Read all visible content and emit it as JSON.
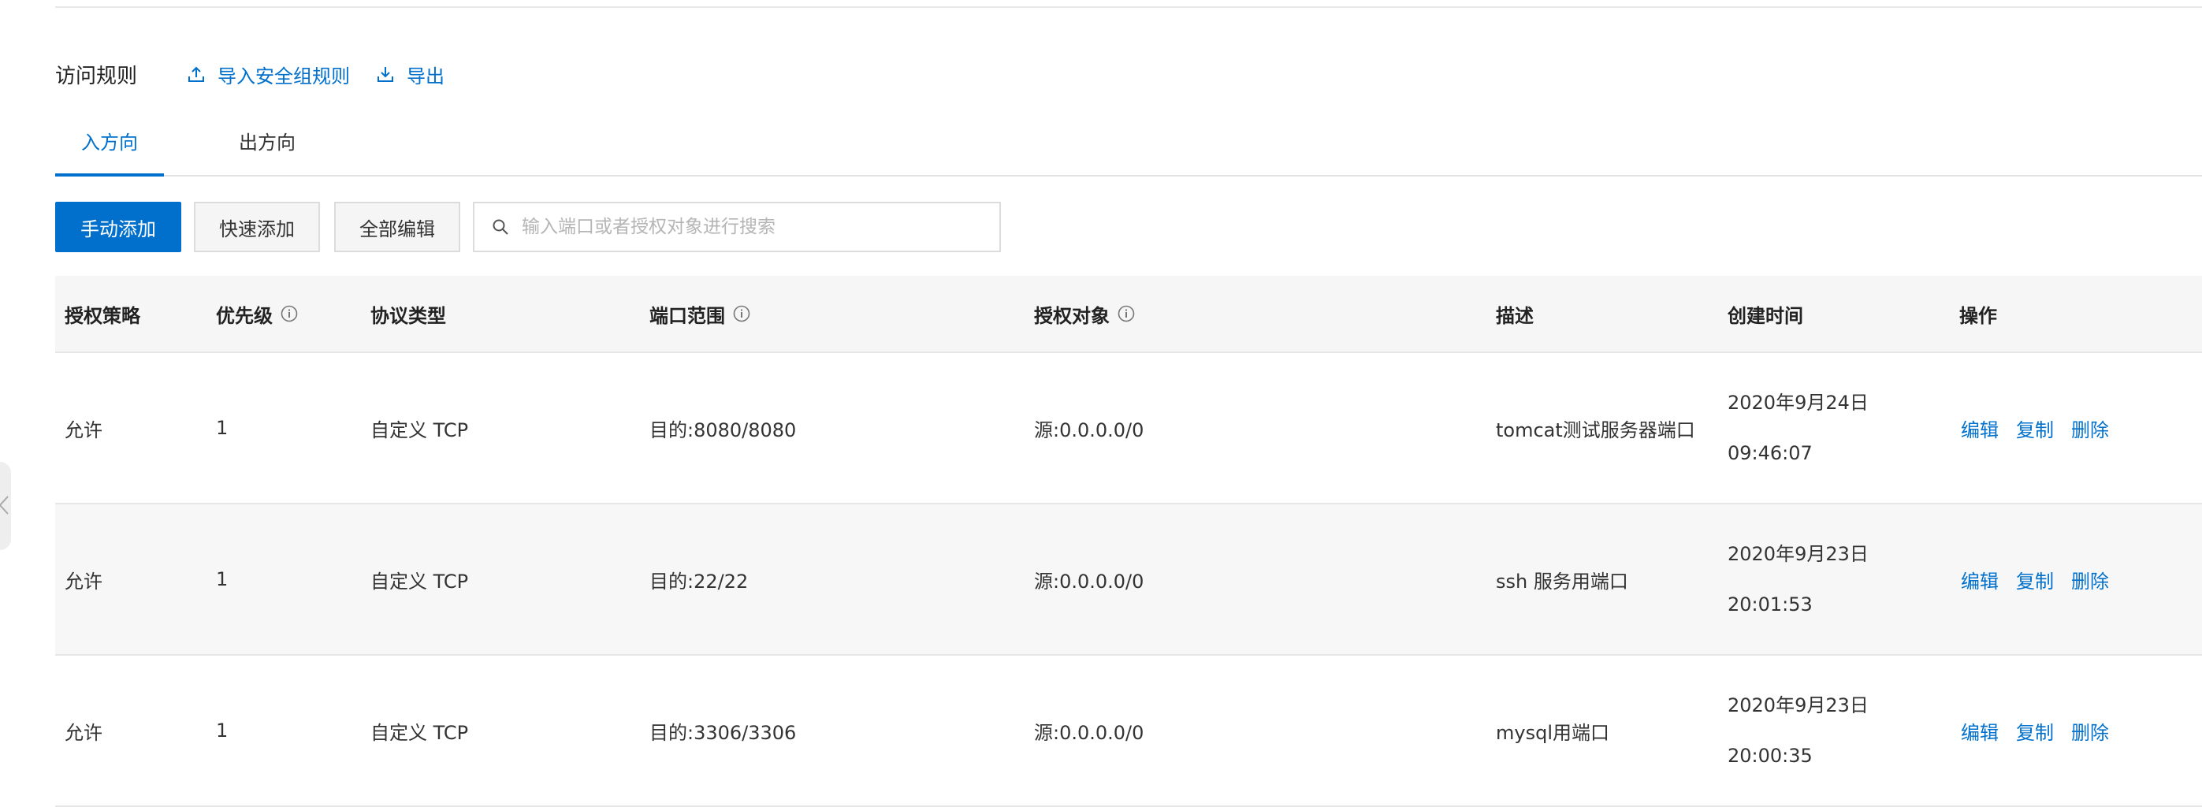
{
  "header": {
    "title": "访问规则",
    "import_label": "导入安全组规则",
    "export_label": "导出"
  },
  "tabs": [
    {
      "label": "入方向",
      "active": true
    },
    {
      "label": "出方向",
      "active": false
    }
  ],
  "toolbar": {
    "manual_add": "手动添加",
    "quick_add": "快速添加",
    "edit_all": "全部编辑",
    "search_placeholder": "输入端口或者授权对象进行搜索",
    "search_value": ""
  },
  "table": {
    "columns": [
      "授权策略",
      "优先级",
      "协议类型",
      "端口范围",
      "授权对象",
      "描述",
      "创建时间",
      "操作"
    ],
    "rows": [
      {
        "policy": "允许",
        "priority": "1",
        "protocol": "自定义 TCP",
        "port": "目的:8080/8080",
        "source": "源:0.0.0.0/0",
        "desc": "tomcat测试服务器端口",
        "date": "2020年9月24日",
        "time": "09:46:07"
      },
      {
        "policy": "允许",
        "priority": "1",
        "protocol": "自定义 TCP",
        "port": "目的:22/22",
        "source": "源:0.0.0.0/0",
        "desc": "ssh 服务用端口",
        "date": "2020年9月23日",
        "time": "20:01:53"
      },
      {
        "policy": "允许",
        "priority": "1",
        "protocol": "自定义 TCP",
        "port": "目的:3306/3306",
        "source": "源:0.0.0.0/0",
        "desc": "mysql用端口",
        "date": "2020年9月23日",
        "time": "20:00:35"
      }
    ],
    "actions": {
      "edit": "编辑",
      "copy": "复制",
      "delete": "删除"
    }
  },
  "colors": {
    "accent": "#0070cc",
    "header_bg": "#f6f6f6",
    "border": "#e6e6e6"
  },
  "icons": [
    "upload-icon",
    "download-icon",
    "search-icon",
    "info-icon",
    "chevron-left-icon"
  ]
}
